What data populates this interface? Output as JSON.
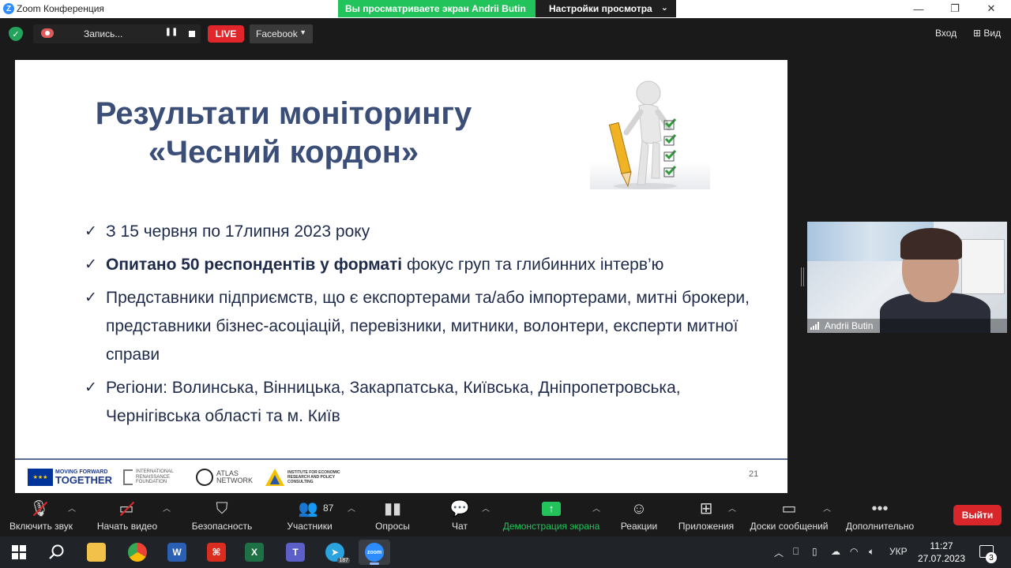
{
  "window": {
    "app_letter": "Z",
    "title": "Zoom Конференция",
    "share_banner": "Вы просматриваете экран Andrii Butin",
    "view_settings": "Настройки просмотра",
    "minimize_glyph": "—",
    "maximize_glyph": "❐",
    "close_glyph": "✕"
  },
  "topbar": {
    "recording_label": "Запись...",
    "live_label": "LIVE",
    "stream_target": "Facebook",
    "enter_label": "Вход",
    "view_label": "Вид"
  },
  "slide": {
    "title_line1": "Результати моніторингу",
    "title_line2": "«Чесний кордон»",
    "bullets": [
      {
        "bold": "",
        "text": "З 15 червня по  17липня 2023 року"
      },
      {
        "bold": "Опитано  50 респондентів у форматі",
        "text": " фокус груп та глибинних інтерв’ю"
      },
      {
        "bold": "",
        "text": "Представники підприємств, що є експортерами та/або імпортерами,   митні брокери, представники бізнес-асоціацій, перевізники, митники, волонтери, експерти  митної справи"
      },
      {
        "bold": "",
        "text": " Регіони: Волинська, Вінницька, Закарпатська, Київська, Дніпропетровська, Чернігівська області та м. Київ"
      }
    ],
    "footer": {
      "mft_line1": "MOVING FORWARD",
      "mft_line2": "TOGETHER",
      "irf": "INTERNATIONAL RENAISSANCE FOUNDATION",
      "atlas_line1": "ATLAS",
      "atlas_line2": "NETWORK",
      "ier": "INSTITUTE FOR ECONOMIC RESEARCH AND POLICY CONSULTING"
    },
    "page_number": "21"
  },
  "video": {
    "participant_name": "Andrii Butin"
  },
  "toolbar": {
    "unmute": "Включить звук",
    "start_video": "Начать видео",
    "security": "Безопасность",
    "participants": "Участники",
    "participants_count": "87",
    "polls": "Опросы",
    "chat": "Чат",
    "share_screen": "Демонстрация экрана",
    "reactions": "Реакции",
    "apps": "Приложения",
    "whiteboards": "Доски сообщений",
    "more": "Дополнительно",
    "leave": "Выйти"
  },
  "taskbar": {
    "telegram_badge": "187",
    "zoom_label": "zoom",
    "language": "УКР",
    "time": "11:27",
    "date": "27.07.2023",
    "notification_count": "3"
  },
  "colors": {
    "share_green": "#23c35b",
    "live_red": "#e0262a",
    "leave_red": "#d9262a",
    "slide_title": "#3b4e77",
    "slide_text": "#1f2b4a"
  }
}
